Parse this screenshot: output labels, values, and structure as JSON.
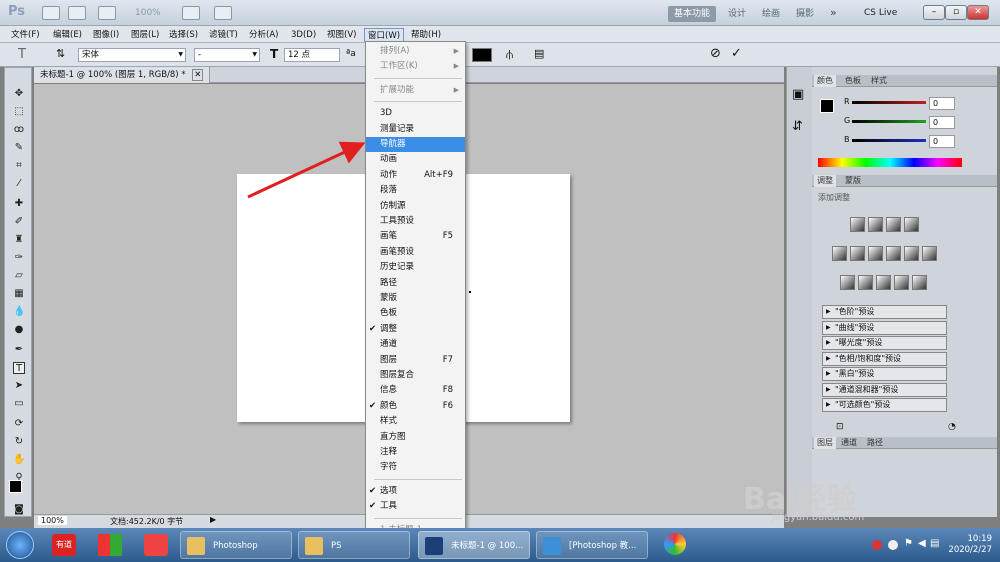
{
  "appbar": {
    "logo": "Ps",
    "zoom": "100%",
    "workspaces": [
      "基本功能",
      "设计",
      "绘画",
      "摄影"
    ],
    "cslive": "CS Live"
  },
  "menubar": [
    "文件(F)",
    "编辑(E)",
    "图像(I)",
    "图层(L)",
    "选择(S)",
    "滤镜(T)",
    "分析(A)",
    "3D(D)",
    "视图(V)",
    "窗口(W)",
    "帮助(H)"
  ],
  "options": {
    "font_family": "宋体",
    "font_style": "-",
    "font_size": "12 点",
    "aa": "a"
  },
  "doc_tab": "未标题-1 @ 100% (图层 1, RGB/8) *",
  "status": {
    "zoom": "100%",
    "docsize": "文档:452.2K/0 字节"
  },
  "window_menu": {
    "top": [
      {
        "label": "排列(A)",
        "sub": true,
        "disabled": true
      },
      {
        "label": "工作区(K)",
        "sub": true,
        "disabled": true
      },
      {
        "label": "扩展功能",
        "sub": true,
        "disabled": true
      }
    ],
    "items": [
      {
        "label": "3D"
      },
      {
        "label": "测量记录"
      },
      {
        "label": "导航器",
        "highlight": true
      },
      {
        "label": "动画"
      },
      {
        "label": "动作",
        "shortcut": "Alt+F9"
      },
      {
        "label": "段落"
      },
      {
        "label": "仿制源"
      },
      {
        "label": "工具预设"
      },
      {
        "label": "画笔",
        "shortcut": "F5"
      },
      {
        "label": "画笔预设"
      },
      {
        "label": "历史记录"
      },
      {
        "label": "路径"
      },
      {
        "label": "蒙版"
      },
      {
        "label": "色板"
      },
      {
        "label": "调整",
        "checked": true
      },
      {
        "label": "通道"
      },
      {
        "label": "图层",
        "shortcut": "F7"
      },
      {
        "label": "图层复合"
      },
      {
        "label": "信息",
        "shortcut": "F8"
      },
      {
        "label": "颜色",
        "shortcut": "F6",
        "checked": true
      },
      {
        "label": "样式"
      },
      {
        "label": "直方图"
      },
      {
        "label": "注释"
      },
      {
        "label": "字符"
      }
    ],
    "bottom": [
      {
        "label": "选项",
        "checked": true
      },
      {
        "label": "工具",
        "checked": true
      }
    ],
    "docs": [
      {
        "label": "1 未标题-1",
        "disabled": true
      }
    ]
  },
  "color_panel": {
    "tabs": [
      "颜色",
      "色板",
      "样式"
    ],
    "channels": [
      {
        "name": "R",
        "value": "0",
        "color": "#c02020"
      },
      {
        "name": "G",
        "value": "0",
        "color": "#20a020"
      },
      {
        "name": "B",
        "value": "0",
        "color": "#2030c0"
      }
    ]
  },
  "adjust_panel": {
    "tabs": [
      "调整",
      "蒙版"
    ],
    "title": "添加调整",
    "presets": [
      "\"色阶\"预设",
      "\"曲线\"预设",
      "\"曝光度\"预设",
      "\"色相/饱和度\"预设",
      "\"黑白\"预设",
      "\"通道混和器\"预设",
      "\"可选颜色\"预设"
    ]
  },
  "layers_panel": {
    "tabs": [
      "图层",
      "通道",
      "路径"
    ]
  },
  "taskbar": {
    "buttons": [
      {
        "label": "Photoshop",
        "icon_color": "#e8c060"
      },
      {
        "label": "PS",
        "icon_color": "#e8c060"
      },
      {
        "label": "未标题-1 @ 100...",
        "icon_color": "#1c3f7a"
      },
      {
        "label": "[Photoshop 教...",
        "icon_color": "#3d8fd8"
      }
    ],
    "time": "10:19",
    "date": "2020/2/27"
  },
  "watermark": {
    "brand": "Bai经验",
    "url": "jingyan.baidu.com"
  }
}
